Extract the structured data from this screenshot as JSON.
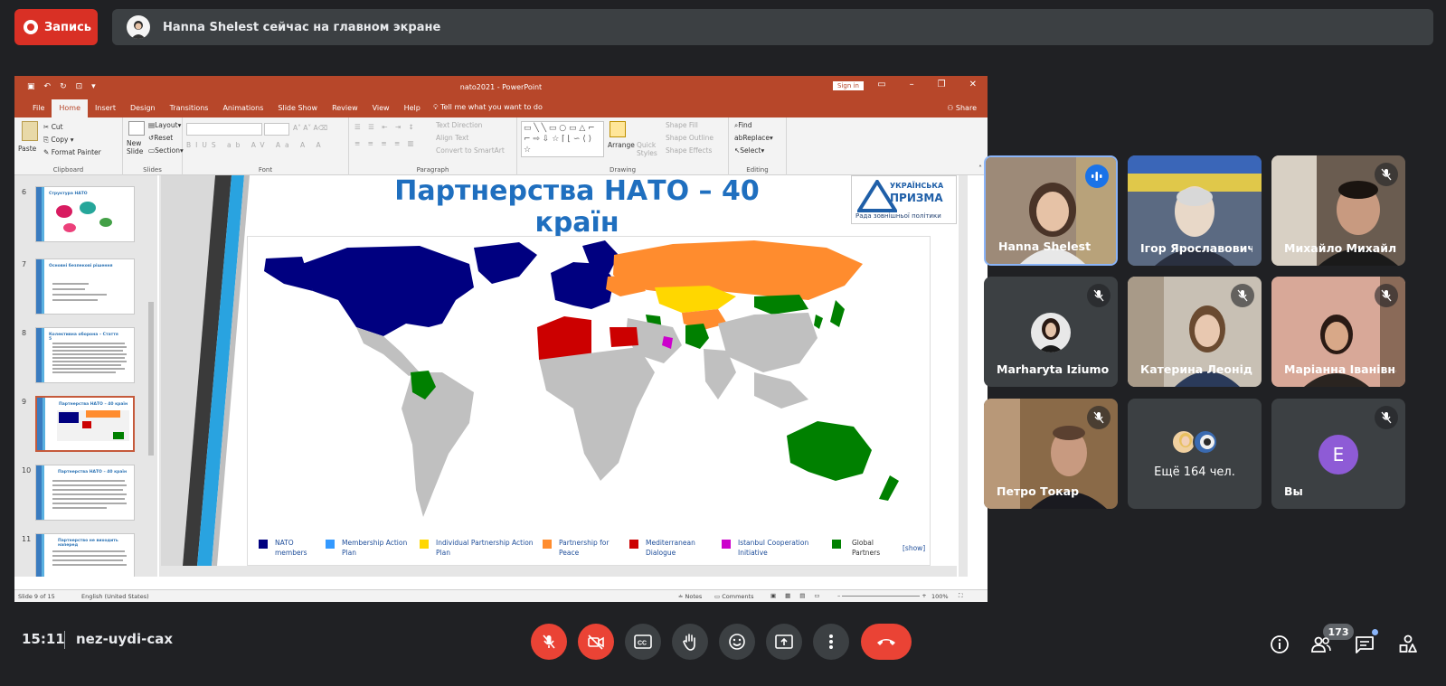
{
  "meet": {
    "record_label": "Запись",
    "banner_text": "Hanna Shelest сейчас на главном экране",
    "clock": "15:11",
    "meeting_code": "nez-uydi-cax",
    "people_count": "173"
  },
  "ppt": {
    "window_title": "nato2021  -  PowerPoint",
    "sign_in": "Sign in",
    "tabs": [
      "File",
      "Home",
      "Insert",
      "Design",
      "Transitions",
      "Animations",
      "Slide Show",
      "Review",
      "View",
      "Help"
    ],
    "tell_me": "Tell me what you want to do",
    "share": "Share",
    "ribbon": {
      "paste": "Paste",
      "cut": "Cut",
      "copy": "Copy",
      "format_painter": "Format Painter",
      "clipboard": "Clipboard",
      "new_slide": "New Slide",
      "layout": "Layout",
      "reset": "Reset",
      "section": "Section",
      "slides": "Slides",
      "font": "Font",
      "text_direction": "Text Direction",
      "align_text": "Align Text",
      "convert_smartart": "Convert to SmartArt",
      "paragraph": "Paragraph",
      "arrange": "Arrange",
      "quick_styles": "Quick Styles",
      "shape_fill": "Shape Fill",
      "shape_outline": "Shape Outline",
      "shape_effects": "Shape Effects",
      "drawing": "Drawing",
      "find": "Find",
      "replace": "Replace",
      "select": "Select",
      "editing": "Editing"
    },
    "thumbnails": [
      {
        "num": "6",
        "title": "Структура НАТО"
      },
      {
        "num": "7",
        "title": "Основні безпекові рішення"
      },
      {
        "num": "8",
        "title": "Колективна оборона – Стаття 5"
      },
      {
        "num": "9",
        "title": "Партнерства НАТО – 40 країн"
      },
      {
        "num": "10",
        "title": "Партнерства НАТО – 40 країн"
      },
      {
        "num": "11",
        "title": "Партнерство не виходить наперед"
      }
    ],
    "slide": {
      "title": "Партнерства НАТО – 40 країн",
      "logo_line1": "УКРАЇНСЬКА",
      "logo_line2": "ПРИЗМА",
      "logo_line3": "Рада зовнішньої політики",
      "legend": [
        {
          "label": "NATO members",
          "color": "#000080"
        },
        {
          "label": "Membership Action Plan",
          "color": "#3399ff"
        },
        {
          "label": "Individual Partnership Action Plan",
          "color": "#ffd700"
        },
        {
          "label": "Partnership for Peace",
          "color": "#ff8c2e"
        },
        {
          "label": "Mediterranean Dialogue",
          "color": "#cc0000"
        },
        {
          "label": "Istanbul Cooperation Initiative",
          "color": "#cc00cc"
        },
        {
          "label": "Global Partners",
          "color": "#008000"
        }
      ],
      "show_link": "[show]"
    },
    "status": {
      "slide_of": "Slide 9 of 15",
      "language": "English (United States)",
      "notes": "Notes",
      "comments": "Comments",
      "zoom": "100%"
    }
  },
  "participants": [
    {
      "name": "Hanna Shelest",
      "speaking": true
    },
    {
      "name": "Ігор Ярославович",
      "muted": false
    },
    {
      "name": "Михайло Михайлович",
      "muted": true
    },
    {
      "name": "Marharyta Iziumova",
      "muted": true
    },
    {
      "name": "Катерина Леонідівна",
      "muted": true
    },
    {
      "name": "Маріанна Іванівна",
      "muted": true
    },
    {
      "name": "Петро Токар",
      "muted": true
    },
    {
      "name": "Ещё 164 чел."
    },
    {
      "name": "Вы",
      "initial": "E",
      "muted": true
    }
  ],
  "colors": {
    "record": "#d93025",
    "bg": "#202124",
    "tile": "#3c4043",
    "ppt_accent": "#b7472a",
    "end_call": "#ea4335",
    "you_avatar": "#8e5bd6"
  }
}
